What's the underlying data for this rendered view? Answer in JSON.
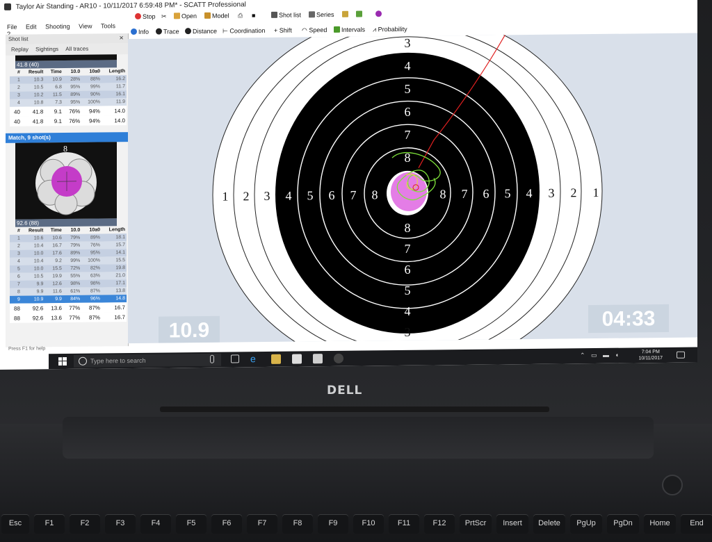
{
  "window": {
    "title": "Taylor Air Standing - AR10 - 10/11/2017 6:59:48 PM* - SCATT Professional"
  },
  "menu": [
    "File",
    "Edit",
    "Shooting",
    "View",
    "Tools",
    "?"
  ],
  "toolbar1": {
    "stop": "Stop",
    "open": "Open",
    "model": "Model",
    "shot_list": "Shot list",
    "series": "Series"
  },
  "toolbar2": [
    "Info",
    "Trace",
    "Distance",
    "Coordination",
    "Shift",
    "Speed",
    "Intervals",
    "Probability"
  ],
  "left_panel": {
    "header": "Shot list",
    "tabs": [
      "Replay",
      "Sightings",
      "All traces"
    ],
    "top_score": "41.8 (40)",
    "columns": [
      "#",
      "Result",
      "Time",
      "10.0",
      "10a0",
      "Length"
    ],
    "sighter_rows": [
      [
        "1",
        "10.3",
        "10.9",
        "28%",
        "88%",
        "16.2"
      ],
      [
        "2",
        "10.5",
        "6.8",
        "95%",
        "99%",
        "11.7"
      ],
      [
        "3",
        "10.2",
        "11.5",
        "89%",
        "90%",
        "16.1"
      ],
      [
        "4",
        "10.8",
        "7.3",
        "95%",
        "100%",
        "11.9"
      ]
    ],
    "sighter_totals": [
      [
        "40",
        "41.8",
        "9.1",
        "76%",
        "94%",
        "14.0"
      ],
      [
        "40",
        "41.8",
        "9.1",
        "76%",
        "94%",
        "14.0"
      ]
    ],
    "match_header": "Match, 9 shot(s)",
    "match_target_number": "8",
    "match_score": "92.6 (88)",
    "match_rows": [
      [
        "1",
        "10.6",
        "10.6",
        "79%",
        "89%",
        "18.1"
      ],
      [
        "2",
        "10.4",
        "16.7",
        "79%",
        "76%",
        "15.7"
      ],
      [
        "3",
        "10.0",
        "17.6",
        "89%",
        "95%",
        "14.1"
      ],
      [
        "4",
        "10.4",
        "9.2",
        "99%",
        "100%",
        "15.5"
      ],
      [
        "5",
        "10.0",
        "15.5",
        "72%",
        "82%",
        "19.8"
      ],
      [
        "6",
        "10.5",
        "19.9",
        "55%",
        "63%",
        "21.0"
      ],
      [
        "7",
        "9.9",
        "12.6",
        "98%",
        "98%",
        "17.1"
      ],
      [
        "8",
        "9.9",
        "11.6",
        "61%",
        "87%",
        "13.8"
      ],
      [
        "9",
        "10.9",
        "9.9",
        "84%",
        "96%",
        "14.8"
      ]
    ],
    "match_totals": [
      [
        "88",
        "92.6",
        "13.6",
        "77%",
        "87%",
        "16.7"
      ],
      [
        "88",
        "92.6",
        "13.6",
        "77%",
        "87%",
        "16.7"
      ]
    ]
  },
  "status_bar": "Press F1 for help",
  "target": {
    "ring_labels_outer_left": [
      "1",
      "2",
      "3"
    ],
    "ring_labels_outer_right": [
      "3",
      "2",
      "1"
    ],
    "ring_labels_inner_left": [
      "4",
      "5",
      "6",
      "7",
      "8"
    ],
    "ring_labels_inner_right": [
      "8",
      "7",
      "6",
      "5",
      "4"
    ],
    "ring_labels_top": [
      "3",
      "4",
      "5",
      "6",
      "7",
      "8"
    ],
    "ring_labels_bottom": [
      "8",
      "7",
      "6",
      "5",
      "4",
      "3"
    ],
    "last_result": "10.9",
    "timer": "04:33",
    "colors": {
      "trace_approach": "#e02020",
      "trace_hold": "#7ee23a",
      "trace_shot": "#e6d24a",
      "shot_marker": "#e47de6"
    }
  },
  "taskbar": {
    "search_placeholder": "Type here to search",
    "time": "7:04 PM",
    "date": "10/11/2017"
  },
  "hardware": {
    "brand": "DELL",
    "keys": [
      "Esc",
      "F1",
      "F2",
      "F3",
      "F4",
      "F5",
      "F6",
      "F7",
      "F8",
      "F9",
      "F10",
      "F11",
      "F12",
      "PrtScr",
      "Insert",
      "Delete",
      "PgUp",
      "PgDn",
      "Home",
      "End"
    ]
  }
}
